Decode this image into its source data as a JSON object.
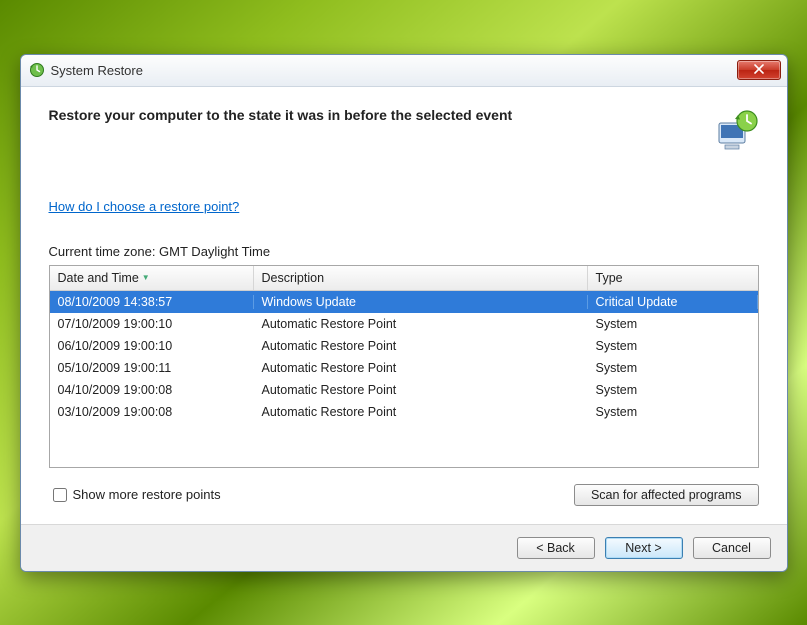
{
  "window": {
    "title": "System Restore"
  },
  "header": {
    "heading": "Restore your computer to the state it was in before the selected event"
  },
  "help_link": "How do I choose a restore point?",
  "timezone_label": "Current time zone: GMT Daylight Time",
  "grid": {
    "columns": [
      "Date and Time",
      "Description",
      "Type"
    ],
    "rows": [
      {
        "datetime": "08/10/2009 14:38:57",
        "description": "Windows Update",
        "type": "Critical Update",
        "selected": true
      },
      {
        "datetime": "07/10/2009 19:00:10",
        "description": "Automatic Restore Point",
        "type": "System",
        "selected": false
      },
      {
        "datetime": "06/10/2009 19:00:10",
        "description": "Automatic Restore Point",
        "type": "System",
        "selected": false
      },
      {
        "datetime": "05/10/2009 19:00:11",
        "description": "Automatic Restore Point",
        "type": "System",
        "selected": false
      },
      {
        "datetime": "04/10/2009 19:00:08",
        "description": "Automatic Restore Point",
        "type": "System",
        "selected": false
      },
      {
        "datetime": "03/10/2009 19:00:08",
        "description": "Automatic Restore Point",
        "type": "System",
        "selected": false
      }
    ],
    "empty_rows": 2
  },
  "show_more_label": "Show more restore points",
  "scan_button": "Scan for affected programs",
  "footer": {
    "back": "< Back",
    "next": "Next >",
    "cancel": "Cancel"
  }
}
